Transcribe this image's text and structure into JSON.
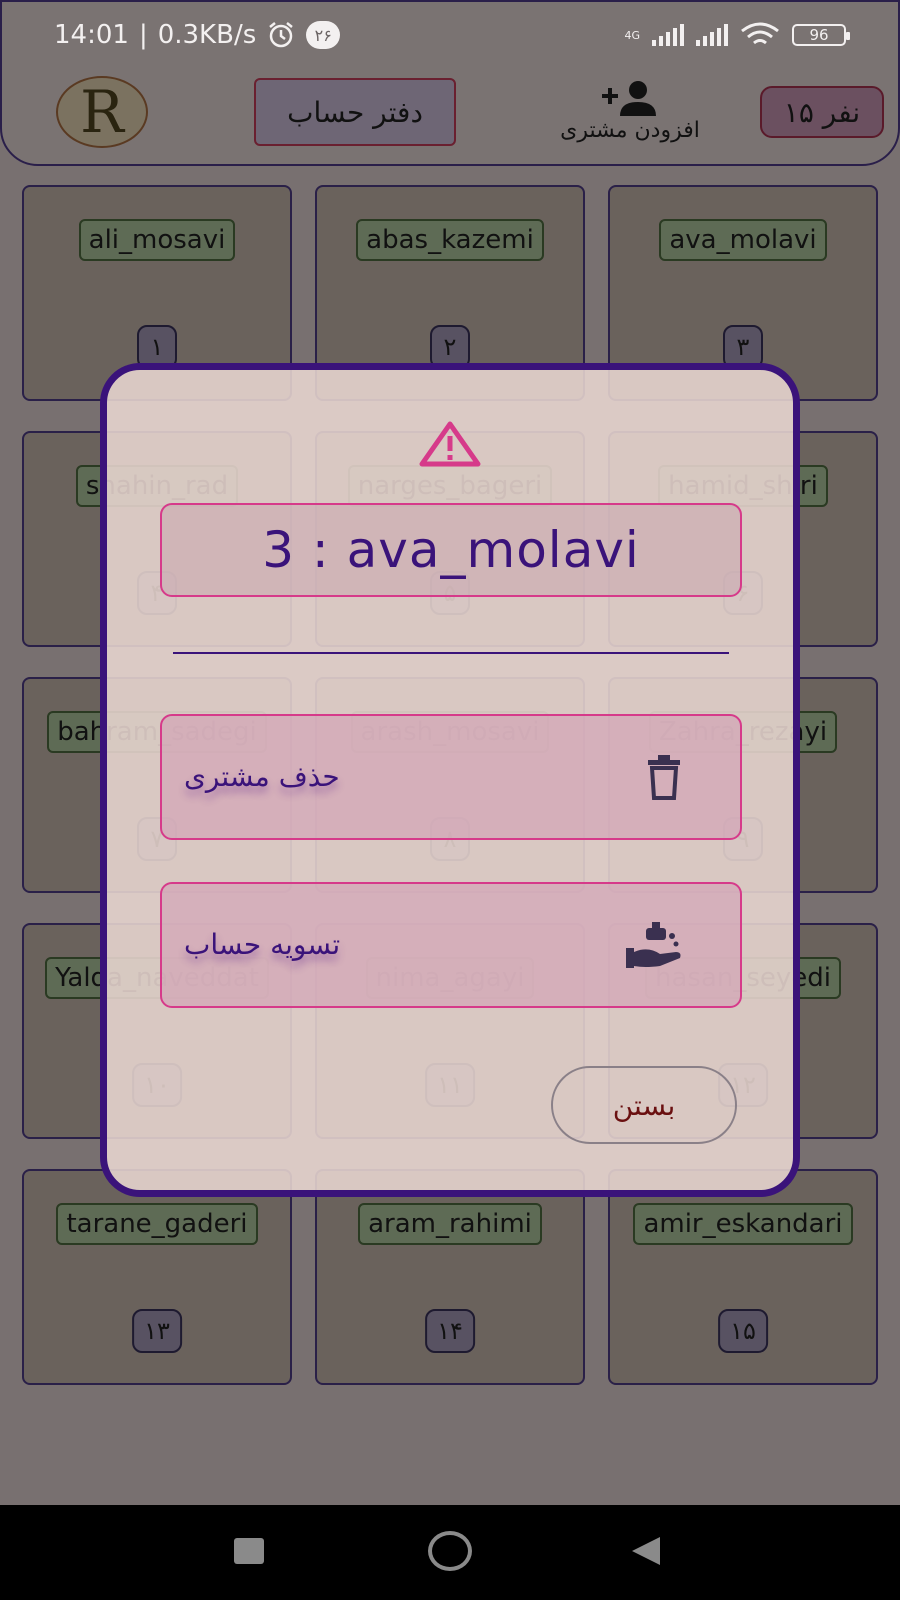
{
  "status_bar": {
    "time": "14:01",
    "net_speed": "0.3KB/s",
    "notif_count": "۲۶",
    "network": "4G",
    "battery": "96"
  },
  "header": {
    "logo_letter": "R",
    "ledger_label": "دفتر حساب",
    "add_customer_label": "افزودن مشتری",
    "count_label": "۱۵ نفر"
  },
  "customers": [
    {
      "name": "ali_mosavi",
      "num": "۱"
    },
    {
      "name": "abas_kazemi",
      "num": "۲"
    },
    {
      "name": "ava_molavi",
      "num": "۳"
    },
    {
      "name": "shahin_rad",
      "num": "۴"
    },
    {
      "name": "narges_bageri",
      "num": "۵"
    },
    {
      "name": "hamid_shiri",
      "num": "۶"
    },
    {
      "name": "bahram_sadegi",
      "num": "۷"
    },
    {
      "name": "arash_mosavi",
      "num": "۸"
    },
    {
      "name": "Zahra_rezayi",
      "num": "۹"
    },
    {
      "name": "Yalda_naveddat",
      "num": "۱۰"
    },
    {
      "name": "nima_agayi",
      "num": "۱۱"
    },
    {
      "name": "hasan_seyedi",
      "num": "۱۲"
    },
    {
      "name": "tarane_gaderi",
      "num": "۱۳"
    },
    {
      "name": "aram_rahimi",
      "num": "۱۴"
    },
    {
      "name": "amir_eskandari",
      "num": "۱۵"
    }
  ],
  "dialog": {
    "title": "3 : ava_molavi",
    "delete_label": "حذف مشتری",
    "settle_label": "تسویه حساب",
    "close_label": "بستن"
  },
  "colors": {
    "dialog_border": "#3a137a",
    "accent_pink": "#d63a8a",
    "text_purple": "#3a137a"
  }
}
